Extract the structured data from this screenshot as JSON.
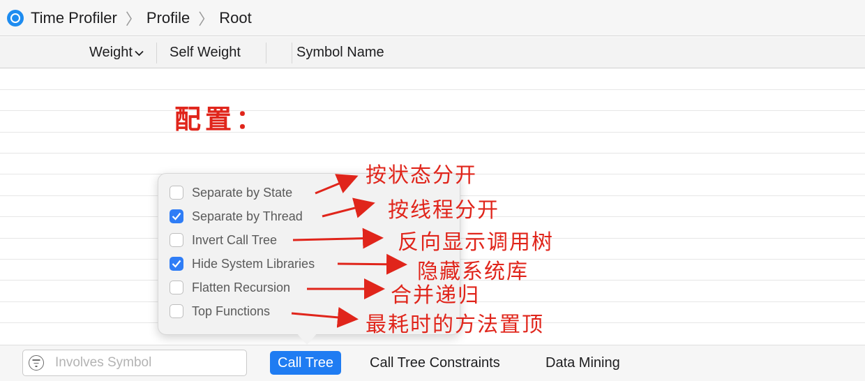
{
  "breadcrumb": {
    "items": [
      "Time Profiler",
      "Profile",
      "Root"
    ],
    "separator": "〉"
  },
  "columns": {
    "weight": "Weight",
    "self_weight": "Self Weight",
    "symbol_name": "Symbol Name"
  },
  "annotations": {
    "title": "配置：",
    "separate_by_state": "按状态分开",
    "separate_by_thread": "按线程分开",
    "invert_call_tree": "反向显示调用树",
    "hide_system_libraries": "隐藏系统库",
    "flatten_recursion": "合并递归",
    "top_functions": "最耗时的方法置顶"
  },
  "options": [
    {
      "label": "Separate by State",
      "checked": false
    },
    {
      "label": "Separate by Thread",
      "checked": true
    },
    {
      "label": "Invert Call Tree",
      "checked": false
    },
    {
      "label": "Hide System Libraries",
      "checked": true
    },
    {
      "label": "Flatten Recursion",
      "checked": false
    },
    {
      "label": "Top Functions",
      "checked": false
    }
  ],
  "bottom_bar": {
    "search_placeholder": "Involves Symbol",
    "tabs": [
      "Call Tree",
      "Call Tree Constraints",
      "Data Mining"
    ],
    "active_tab": "Call Tree"
  },
  "colors": {
    "accent": "#1f7cf2",
    "annotation": "#e0251b"
  }
}
